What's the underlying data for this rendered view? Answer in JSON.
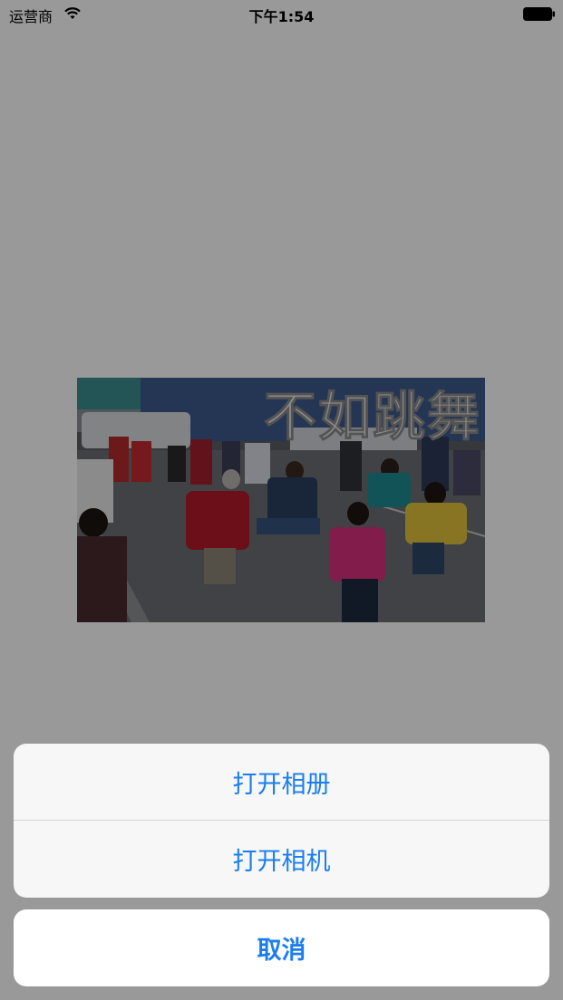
{
  "status_bar": {
    "carrier": "运营商",
    "time": "下午1:54",
    "wifi_icon": "wifi-icon",
    "battery_icon": "battery-icon"
  },
  "photo": {
    "caption": "不如跳舞"
  },
  "action_sheet": {
    "items": [
      {
        "label": "打开相册"
      },
      {
        "label": "打开相机"
      }
    ],
    "cancel_label": "取消"
  },
  "colors": {
    "accent": "#1a7ef0",
    "overlay": "#000000"
  }
}
